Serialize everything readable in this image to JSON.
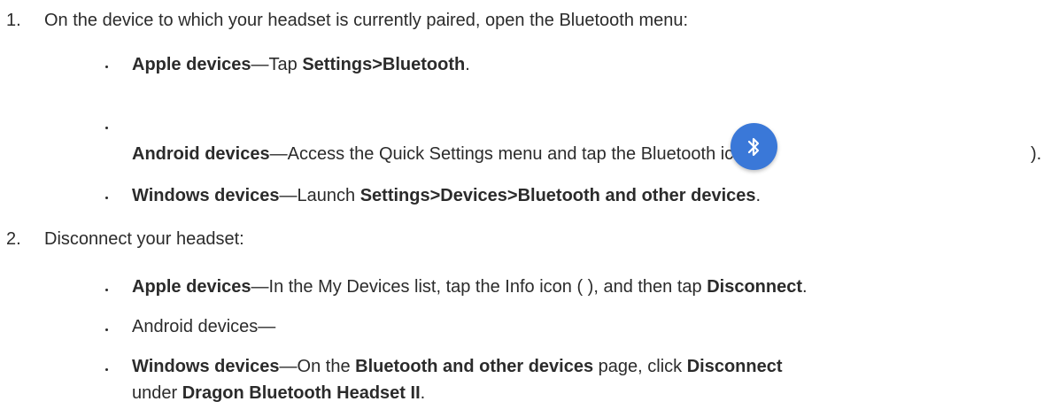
{
  "steps": [
    {
      "number": "1.",
      "text": "On the device to which your headset is currently paired, open the Bluetooth menu:"
    },
    {
      "number": "2.",
      "text": "Disconnect your headset:"
    }
  ],
  "step1_bullets": {
    "apple": {
      "bold1": "Apple devices",
      "text1": "—Tap ",
      "bold2": "Settings>Bluetooth",
      "text2": "."
    },
    "android": {
      "bold1": "Android devices",
      "text1": "—Access the Quick Settings menu and tap the Bluetooth icon (",
      "text2": ")."
    },
    "windows": {
      "bold1": "Windows devices",
      "text1": "—Launch ",
      "bold2": "Settings>Devices>Bluetooth and other devices",
      "text2": "."
    }
  },
  "step2_bullets": {
    "apple": {
      "bold1": "Apple devices",
      "text1": "—In the My Devices list, tap the Info icon ( ), and then tap ",
      "bold2": "Disconnect",
      "text2": "."
    },
    "android": {
      "text1": "Android devices—"
    },
    "windows": {
      "bold1": "Windows devices",
      "text1": "—On the ",
      "bold2": "Bluetooth and other devices",
      "text2": " page, click ",
      "bold3": "Disconnect",
      "text3": "under ",
      "bold4": "Dragon Bluetooth Headset II",
      "text4": "."
    }
  },
  "icons": {
    "bluetooth_icon": "bluetooth-icon",
    "bluetooth_icon_color": "#3a78d8"
  }
}
